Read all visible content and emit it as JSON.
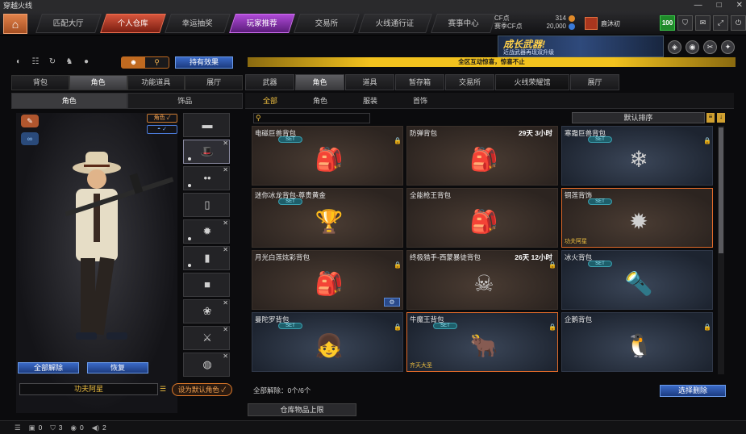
{
  "window": {
    "title": "穿越火线",
    "btn_min": "—",
    "btn_max": "□",
    "btn_close": "✕"
  },
  "nav": {
    "tabs": [
      {
        "label": "匹配大厅"
      },
      {
        "label": "个人仓库"
      },
      {
        "label": "幸运抽奖"
      },
      {
        "label": "玩家推荐"
      },
      {
        "label": "交易所"
      },
      {
        "label": "火线通行证"
      },
      {
        "label": "赛事中心"
      }
    ],
    "cf_label": "CF点",
    "cf_value": "314",
    "cf2_label": "赛季CF点",
    "cf2_value": "20,000",
    "username": "鹿沐初",
    "level": "100"
  },
  "banner": {
    "title": "成长武器!",
    "subtitle": "近战武器再现双升级"
  },
  "announcement": "全区互动惊喜，惊喜不止",
  "left": {
    "toggle_a": "☻",
    "toggle_b": "⚲",
    "effect_btn": "持有效果",
    "tabs": [
      "背包",
      "角色",
      "功能道具",
      "展厅"
    ],
    "subtabs": [
      "角色",
      "饰品"
    ],
    "badge_role": "角色 ✓",
    "badge_eye": "◓ ✓",
    "btn_unequip_all": "全部解除",
    "btn_restore": "恢复",
    "character_name": "功夫阿星",
    "btn_set_default": "设为默认角色 ✓"
  },
  "right": {
    "tabs": [
      "武器",
      "角色",
      "道具",
      "暂存箱",
      "交易所",
      "火线荣耀馆",
      "展厅"
    ],
    "subtabs": [
      "全部",
      "角色",
      "服装",
      "首饰"
    ],
    "search_placeholder": "",
    "sort_label": "默认排序",
    "items": [
      {
        "name": "电磁巨兽背包",
        "time": "",
        "set": "SET",
        "foot": "",
        "art": "🎒"
      },
      {
        "name": "防弹背包",
        "time": "29天 3小时",
        "set": "",
        "foot": "",
        "art": "🎒"
      },
      {
        "name": "寒霜巨兽背包",
        "time": "",
        "set": "SET",
        "foot": "",
        "art": "❄"
      },
      {
        "name": "迷你冰龙背包-尊贵黄金",
        "time": "",
        "set": "SET",
        "foot": "",
        "art": "🏆"
      },
      {
        "name": "全能枪王背包",
        "time": "",
        "set": "",
        "foot": "",
        "art": "🎒"
      },
      {
        "name": "铜莲背饰",
        "time": "",
        "set": "SET",
        "foot": "功夫阿星",
        "art": "✹"
      },
      {
        "name": "月光白莲炫彩背包",
        "time": "",
        "set": "",
        "foot": "",
        "art": "🎒"
      },
      {
        "name": "终极猎手-西蒙暴徒背包",
        "time": "26天 12小时",
        "set": "",
        "foot": "",
        "art": "☠"
      },
      {
        "name": "冰火背包",
        "time": "",
        "set": "SET",
        "foot": "",
        "art": "🔦"
      },
      {
        "name": "曼陀罗背包",
        "time": "",
        "set": "SET",
        "foot": "",
        "art": "👧"
      },
      {
        "name": "牛魔王背包",
        "time": "",
        "set": "SET",
        "foot": "齐天大圣",
        "art": "🐂"
      },
      {
        "name": "企鹅背包",
        "time": "",
        "set": "",
        "foot": "",
        "art": "🐧"
      }
    ],
    "unequip_text": "全部解除：0个/6个",
    "btn_select_delete": "选择删除",
    "storage_btn": "仓库物品上限"
  },
  "status": {
    "a": "0",
    "b": "3",
    "c": "0",
    "d": "2"
  }
}
